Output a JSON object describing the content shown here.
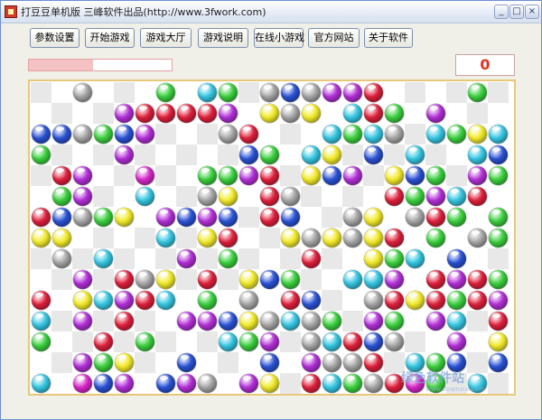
{
  "window": {
    "title": "打豆豆单机版  三峰软件出品(http://www.3fwork.com)",
    "controls": {
      "minimize": "_",
      "maximize": "□",
      "close": "×"
    }
  },
  "toolbar": {
    "buttons": [
      {
        "label": "参数设置"
      },
      {
        "label": "开始游戏"
      },
      {
        "label": "游戏大厅"
      },
      {
        "label": "游戏说明"
      },
      {
        "label": "在线小游戏"
      },
      {
        "label": "官方网站"
      },
      {
        "label": "关于软件"
      }
    ]
  },
  "status": {
    "score": "0",
    "time_fraction": 0.45
  },
  "board": {
    "cols": 23,
    "rows": 15,
    "colors": {
      "G": "#a7a7a7",
      "Y": "#f4ec2a",
      "C": "#35c7e3",
      "B": "#2a52d6",
      "R": "#e0203c",
      "P": "#b32fd8",
      "M": "#d826c8",
      "N": "#3bd13e"
    },
    "layout": [
      "..G...N.CN.GBGPPR....N.",
      "....PRRRRP.YGY.CRN.P...",
      "BBGNBP...GR...CNCG.CNYC",
      "N...P.....BN.CY.B.C..CB",
      ".RP..M..NNPR.YBP.YBN.PN",
      ".NP..C..GY.RG....RNPCR.",
      "RBGNY.PBPB.RB..GY.GRN.N",
      "YY....C.YR..YGYGYR.N.GN",
      ".G.C...P.N...R..YNC.B..",
      "..P.RGY.R.YBN..CCP.RPRN",
      "R.YCPRC.N.G.RB..GRYRNRP",
      "C.P.R..PPBYGCGN.PN.PC.R",
      "N..R.N...CNP.GCRBG..P.Y",
      "..PNY..B...B.PGGR.CNB.B",
      "C.MBP.BPG.PY.RCNGRMN.C."
    ]
  },
  "watermark": {
    "text": "绿色软件站",
    "sub": "www.downxia.com"
  }
}
